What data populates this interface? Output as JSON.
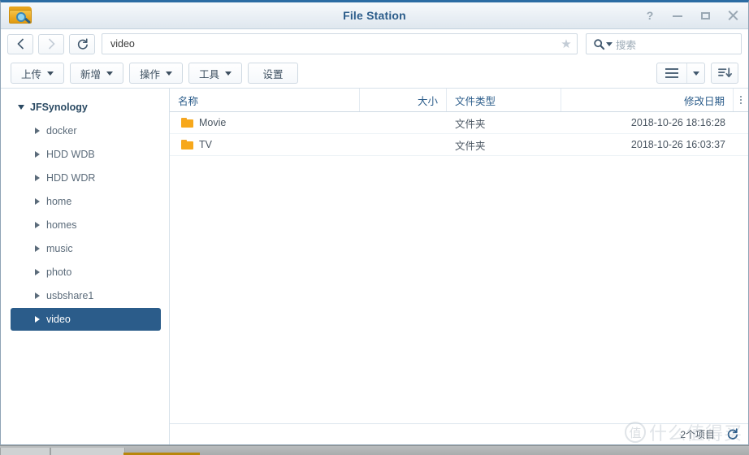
{
  "window": {
    "title": "File Station",
    "app_icon": "folder-search-icon",
    "controls": {
      "help": "?",
      "minimize": "minimize-icon",
      "maximize": "maximize-icon",
      "close": "close-icon"
    }
  },
  "nav": {
    "back_icon": "chevron-left-icon",
    "forward_icon": "chevron-right-icon",
    "refresh_icon": "refresh-icon",
    "address_value": "video",
    "favorite_icon": "star-icon",
    "search_icon": "search-icon",
    "search_placeholder": "搜索"
  },
  "toolbar": {
    "buttons": [
      {
        "label": "上传",
        "has_caret": true
      },
      {
        "label": "新增",
        "has_caret": true
      },
      {
        "label": "操作",
        "has_caret": true
      },
      {
        "label": "工具",
        "has_caret": true
      },
      {
        "label": "设置",
        "has_caret": false
      }
    ],
    "view_button_icon": "list-view-icon",
    "view_caret_icon": "chevron-down-icon",
    "sort_button_icon": "sort-descending-icon"
  },
  "sidebar": {
    "root": {
      "label": "JFSynology",
      "expanded": true
    },
    "items": [
      {
        "label": "docker",
        "selected": false
      },
      {
        "label": "HDD WDB",
        "selected": false
      },
      {
        "label": "HDD WDR",
        "selected": false
      },
      {
        "label": "home",
        "selected": false
      },
      {
        "label": "homes",
        "selected": false
      },
      {
        "label": "music",
        "selected": false
      },
      {
        "label": "photo",
        "selected": false
      },
      {
        "label": "usbshare1",
        "selected": false
      },
      {
        "label": "video",
        "selected": true
      }
    ]
  },
  "filelist": {
    "columns": {
      "name": "名称",
      "size": "大小",
      "type": "文件类型",
      "date": "修改日期"
    },
    "column_menu_icon": "more-vertical-icon",
    "rows": [
      {
        "name": "Movie",
        "size": "",
        "type": "文件夹",
        "date": "2018-10-26 18:16:28",
        "icon": "folder-icon"
      },
      {
        "name": "TV",
        "size": "",
        "type": "文件夹",
        "date": "2018-10-26 16:03:37",
        "icon": "folder-icon"
      }
    ]
  },
  "statusbar": {
    "item_count": "2个项目",
    "refresh_icon": "refresh-icon"
  },
  "watermark": {
    "mark": "值",
    "text": "什么值得买"
  },
  "colors": {
    "title_blue": "#2b5c8a",
    "selection_blue": "#2b5c8a",
    "folder_orange": "#f7a81b",
    "window_border_top": "#2b6ca3"
  }
}
